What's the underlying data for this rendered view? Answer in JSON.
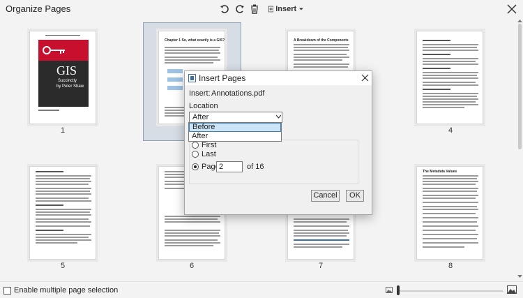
{
  "header": {
    "title": "Organize Pages",
    "insert_label": "Insert",
    "icons": [
      "rotate-left-icon",
      "rotate-right-icon",
      "delete-icon",
      "insert-icon",
      "chevron-down-icon",
      "close-icon"
    ]
  },
  "pages": [
    {
      "number": "1",
      "kind": "cover",
      "cover_title": "GIS",
      "cover_subtitle": "Succinctly",
      "cover_author": "by Peter Shaw"
    },
    {
      "number": "2",
      "kind": "text",
      "heading": "Chapter 1  So, what exactly is a GIS?"
    },
    {
      "number": "3",
      "kind": "text",
      "heading": "A Breakdown of the Components"
    },
    {
      "number": "4",
      "kind": "text",
      "heading": ""
    },
    {
      "number": "5",
      "kind": "text",
      "heading": ""
    },
    {
      "number": "6",
      "kind": "text",
      "heading": ""
    },
    {
      "number": "7",
      "kind": "text",
      "heading": ""
    },
    {
      "number": "8",
      "kind": "text",
      "heading": "The Metadata Values"
    }
  ],
  "dialog": {
    "title": "Insert Pages",
    "insert_label": "Insert:",
    "insert_value": "Annotations.pdf",
    "location_label": "Location",
    "location_value": "After",
    "location_options": [
      "Before",
      "After"
    ],
    "highlighted_option": "Before",
    "radio_first": "First",
    "radio_last": "Last",
    "radio_page": "Page:",
    "page_value": "2",
    "page_total": "of 16",
    "cancel_label": "Cancel",
    "ok_label": "OK"
  },
  "footer": {
    "multi_select_label": "Enable multiple page selection",
    "multi_select_checked": false,
    "zoom_level": 0.0
  }
}
